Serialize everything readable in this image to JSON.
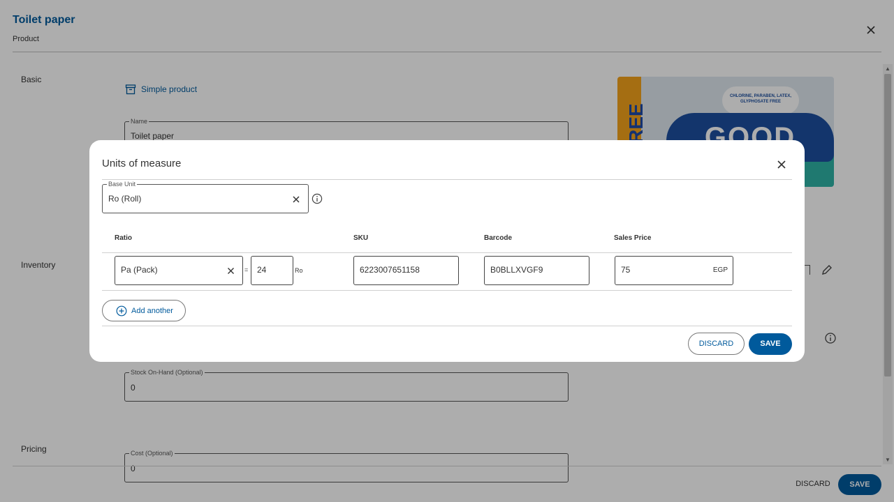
{
  "page": {
    "title": "Toilet paper",
    "subtitle": "Product",
    "sections": {
      "basic": "Basic",
      "inventory": "Inventory",
      "pricing": "Pricing"
    },
    "product_type": "Simple product",
    "name_field": {
      "label": "Name",
      "value": "Toilet paper"
    },
    "stock_field": {
      "label": "Stock On-Hand (Optional)",
      "value": "0"
    },
    "cost_field": {
      "label": "Cost (Optional)",
      "value": "0"
    },
    "image_text": {
      "free": "FREE",
      "brand": "GOOD",
      "tagline": "CHLORINE, PARABEN, LATEX, GLYPHOSATE FREE"
    },
    "footer": {
      "discard": "DISCARD",
      "save": "SAVE"
    }
  },
  "modal": {
    "title": "Units of measure",
    "base_unit": {
      "label": "Base Unit",
      "value": "Ro (Roll)"
    },
    "columns": {
      "ratio": "Ratio",
      "sku": "SKU",
      "barcode": "Barcode",
      "sales_price": "Sales Price"
    },
    "rows": [
      {
        "unit": "Pa (Pack)",
        "equals": "=",
        "ratio": "24",
        "base_unit_abbr": "Ro",
        "sku": "6223007651158",
        "barcode": "B0BLLXVGF9",
        "price": "75",
        "currency": "EGP"
      }
    ],
    "add_another": "Add another",
    "discard": "DISCARD",
    "save": "SAVE"
  },
  "colors": {
    "accent": "#005a9c",
    "overlay": "rgba(0,0,0,0.32)"
  }
}
